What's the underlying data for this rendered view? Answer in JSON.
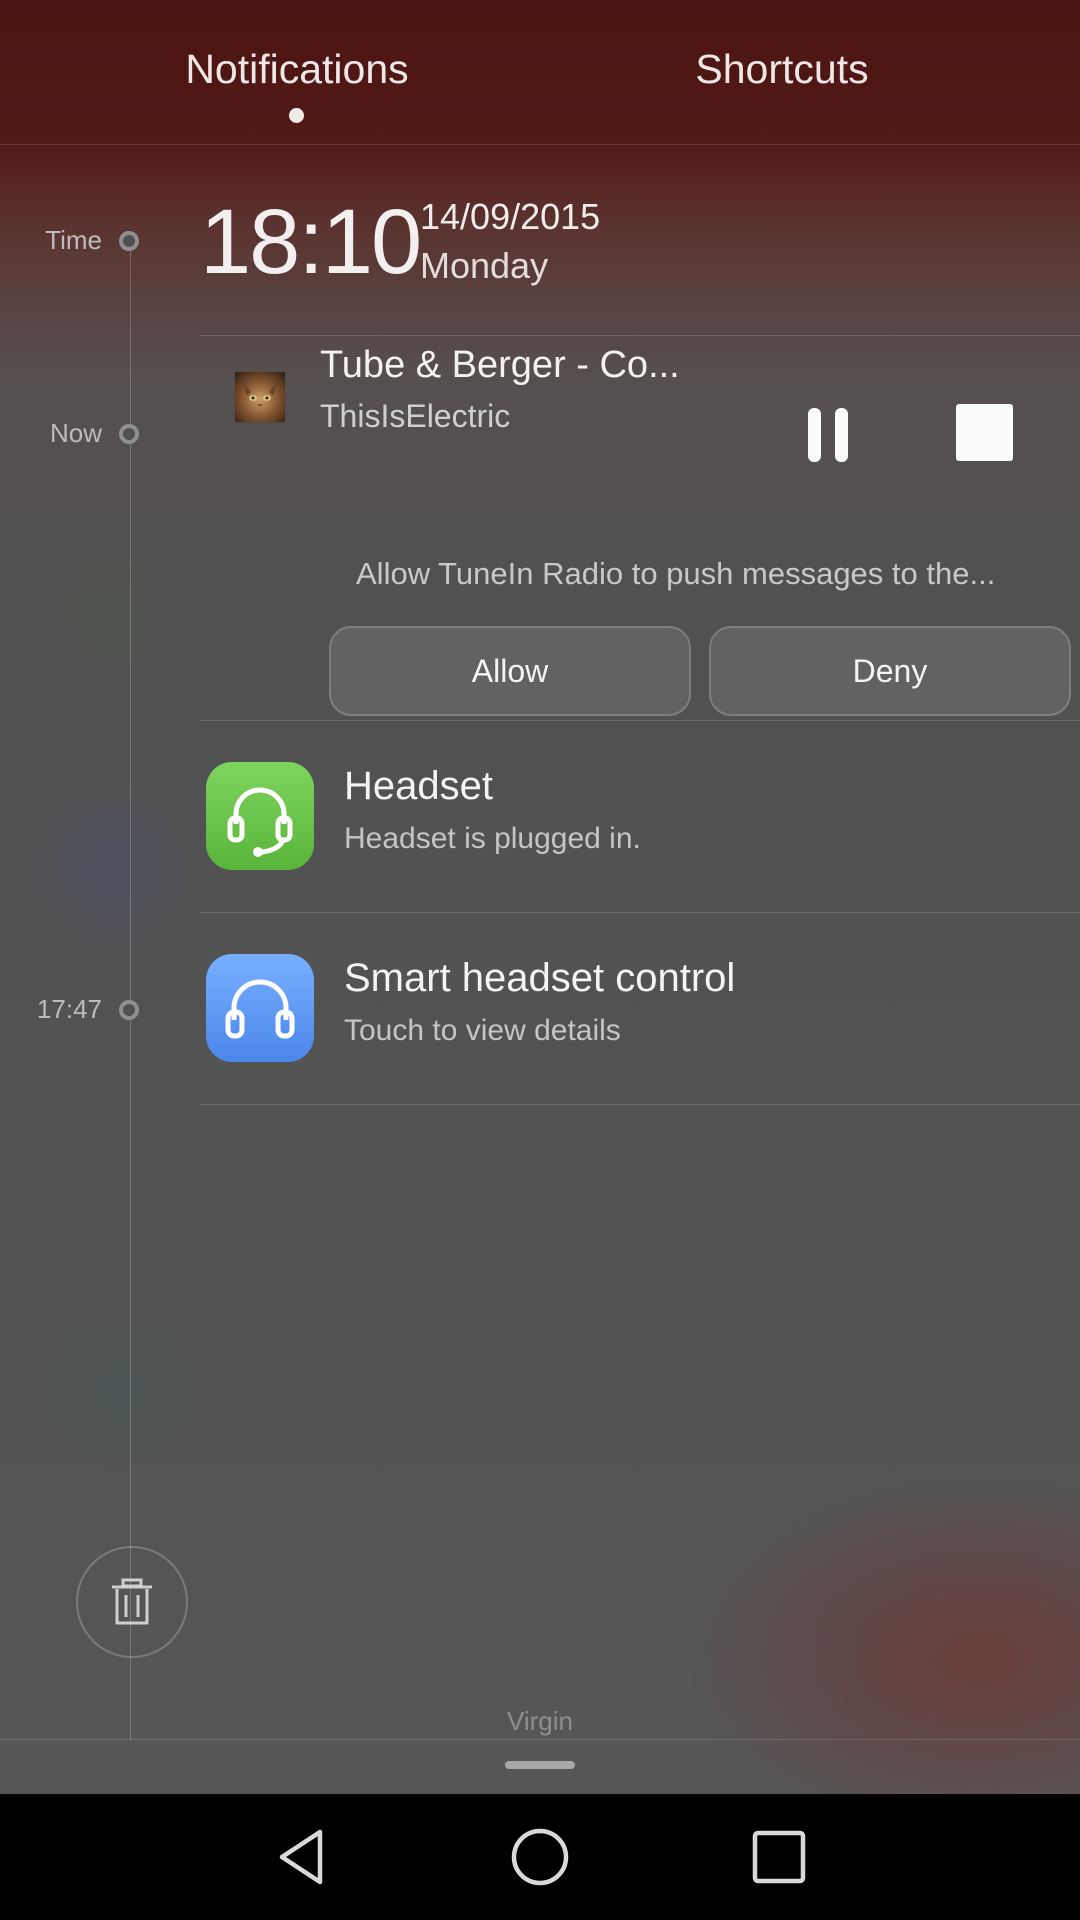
{
  "tabs": {
    "notifications": "Notifications",
    "shortcuts": "Shortcuts"
  },
  "timeline": {
    "time_label": "Time",
    "now_label": "Now",
    "earlier_label": "17:47"
  },
  "clock": {
    "time": "18:10",
    "date": "14/09/2015",
    "day": "Monday"
  },
  "media": {
    "title": "Tube & Berger - Co...",
    "artist": "ThisIsElectric"
  },
  "permission": {
    "message": "Allow TuneIn Radio to push messages to the...",
    "allow_label": "Allow",
    "deny_label": "Deny"
  },
  "notifications": [
    {
      "title": "Headset",
      "subtitle": "Headset is plugged in.",
      "icon": "headset-icon",
      "color": "#6cc64c"
    },
    {
      "title": "Smart headset control",
      "subtitle": "Touch to view details",
      "icon": "headphones-icon",
      "color": "#5e99f5"
    }
  ],
  "carrier": "Virgin"
}
